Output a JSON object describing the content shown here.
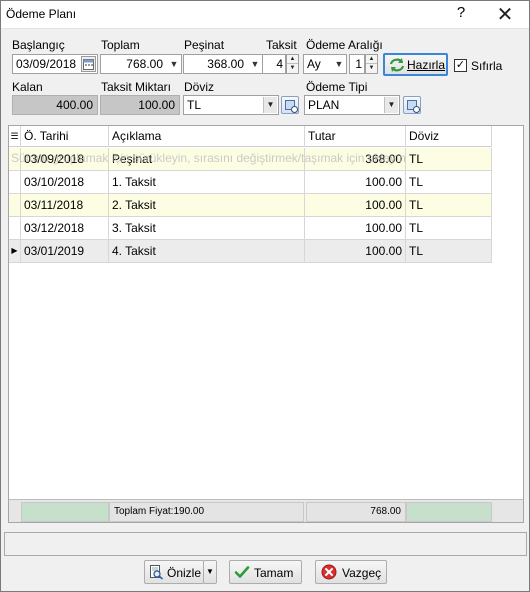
{
  "window": {
    "title": "Ödeme Planı",
    "help": "?",
    "close": "✕"
  },
  "form": {
    "start_label": "Başlangıç",
    "start_value": "03/09/2018",
    "total_label": "Toplam",
    "total_value": "768.00",
    "down_label": "Peşinat",
    "down_value": "368.00",
    "installment_label": "Taksit",
    "installment_value": "4",
    "interval_label": "Ödeme Aralığı",
    "interval_unit": "Ay",
    "interval_value": "1",
    "prepare_button": "Hazırla",
    "reset_label": "Sıfırla",
    "reset_checked": true,
    "remaining_label": "Kalan",
    "remaining_value": "400.00",
    "amount_label": "Taksit Miktarı",
    "amount_value": "100.00",
    "currency_label": "Döviz",
    "currency_value": "TL",
    "paytype_label": "Ödeme Tipi",
    "paytype_value": "PLAN"
  },
  "grid": {
    "columns": [
      "Ö. Tarihi",
      "Açıklama",
      "Tutar",
      "Döviz"
    ],
    "group_hint": "Sütunu gruplamak için sürükleyin, sırasını değiştirmek/taşımak için tıklayın",
    "rows": [
      {
        "date": "03/09/2018",
        "desc": "Peşinat",
        "amount": "368.00",
        "currency": "TL"
      },
      {
        "date": "03/10/2018",
        "desc": "1. Taksit",
        "amount": "100.00",
        "currency": "TL"
      },
      {
        "date": "03/11/2018",
        "desc": "2. Taksit",
        "amount": "100.00",
        "currency": "TL"
      },
      {
        "date": "03/12/2018",
        "desc": "3. Taksit",
        "amount": "100.00",
        "currency": "TL"
      },
      {
        "date": "03/01/2019",
        "desc": "4. Taksit",
        "amount": "100.00",
        "currency": "TL"
      }
    ],
    "footer_label": "Toplam Fiyat:190.00",
    "footer_total": "768.00"
  },
  "buttons": {
    "preview": "Önizle",
    "ok": "Tamam",
    "cancel": "Vazgeç"
  },
  "colors": {
    "odd_row": "#fdfde4",
    "footer_accent": "#c6e0cc",
    "focus": "#3c86d8"
  }
}
